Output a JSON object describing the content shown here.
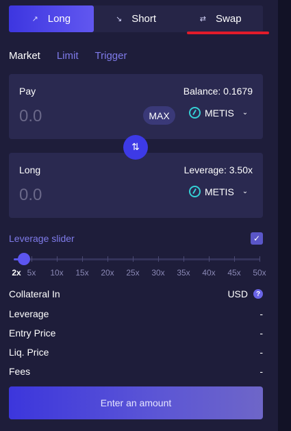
{
  "tabs": [
    {
      "label": "Long",
      "icon": "trend-up-icon",
      "glyph": "↗",
      "active": true
    },
    {
      "label": "Short",
      "icon": "trend-down-icon",
      "glyph": "↘",
      "active": false
    },
    {
      "label": "Swap",
      "icon": "swap-arrows-icon",
      "glyph": "⇄",
      "active": false
    }
  ],
  "order_types": [
    "Market",
    "Limit",
    "Trigger"
  ],
  "pay": {
    "label": "Pay",
    "balance": "Balance: 0.1679",
    "amount_placeholder": "0.0",
    "max_label": "MAX",
    "token": "METIS"
  },
  "switch_glyph": "⇅",
  "long": {
    "label": "Long",
    "leverage_text": "Leverage: 3.50x",
    "amount_placeholder": "0.0",
    "token": "METIS"
  },
  "leverage": {
    "title": "Leverage slider",
    "enabled": true,
    "check_glyph": "✓",
    "ticks": [
      "2x",
      "5x",
      "10x",
      "15x",
      "20x",
      "25x",
      "30x",
      "35x",
      "40x",
      "45x",
      "50x"
    ],
    "current_index": 0
  },
  "info": {
    "collateral_label": "Collateral In",
    "collateral_value": "USD",
    "help_glyph": "?",
    "leverage_label": "Leverage",
    "leverage_value": "-",
    "entry_label": "Entry Price",
    "entry_value": "-",
    "liq_label": "Liq. Price",
    "liq_value": "-",
    "fees_label": "Fees",
    "fees_value": "-"
  },
  "cta_label": "Enter an amount",
  "colors": {
    "accent": "#3d36e0",
    "inactive_link": "#7f7bea",
    "token_icon": "#35d0d5",
    "annotation_underline": "#e21b2a"
  }
}
